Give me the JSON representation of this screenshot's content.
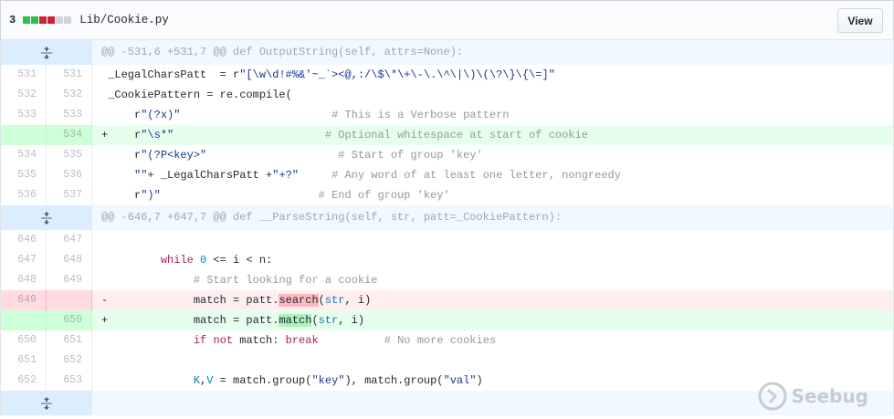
{
  "file": {
    "change_count": "3",
    "stat_colors": [
      "#2cbe4e",
      "#2cbe4e",
      "#cb2431",
      "#cb2431",
      "#d1d5da",
      "#d1d5da"
    ],
    "path": "Lib/Cookie.py",
    "view_label": "View"
  },
  "hunks": [
    {
      "header": "@@ -531,6 +531,7 @@ def OutputString(self, attrs=None):"
    },
    {
      "header": "@@ -646,7 +647,7 @@ def __ParseString(self, str, patt=_CookiePattern):"
    }
  ],
  "lines": {
    "l0": {
      "old": "531",
      "new": "531"
    },
    "l1": {
      "old": "532",
      "new": "532"
    },
    "l2": {
      "old": "533",
      "new": "533"
    },
    "l3": {
      "old": "",
      "new": "534"
    },
    "l4": {
      "old": "534",
      "new": "535"
    },
    "l5": {
      "old": "535",
      "new": "536"
    },
    "l6": {
      "old": "536",
      "new": "537"
    },
    "l7": {
      "old": "646",
      "new": "647"
    },
    "l8": {
      "old": "647",
      "new": "648"
    },
    "l9": {
      "old": "648",
      "new": "649"
    },
    "l10": {
      "old": "649",
      "new": ""
    },
    "l11": {
      "old": "",
      "new": "650"
    },
    "l12": {
      "old": "650",
      "new": "651"
    },
    "l13": {
      "old": "651",
      "new": "652"
    },
    "l14": {
      "old": "652",
      "new": "653"
    }
  },
  "code": {
    "c0": {
      "a": " _LegalCharsPatt  = r",
      "b": "\"[\\w\\d!#%&'~_`><@,:/\\$\\*\\+\\-\\.\\^\\|\\)\\(\\?\\}\\{\\=]\""
    },
    "c1": {
      "a": " _CookiePattern = re.compile("
    },
    "c2": {
      "a": "     r",
      "b": "\"(?x)\"",
      "c": "                       # This is a Verbose pattern"
    },
    "c3": {
      "a": "+    r",
      "b": "\"\\s*\"",
      "c": "                       # Optional whitespace at start of cookie"
    },
    "c4": {
      "a": "     r",
      "b": "\"(?P<key>\"",
      "c": "                    # Start of group 'key'"
    },
    "c5": {
      "a": "     ",
      "b": "\"\"",
      "d": "+ _LegalCharsPatt +",
      "e": "\"+?\"",
      "c": "     # Any word of at least one letter, nongreedy"
    },
    "c6": {
      "a": "     r",
      "b": "\")\"",
      "c": "                        # End of group 'key'"
    },
    "c7": {
      "a": ""
    },
    "c8": {
      "a": "         ",
      "kw": "while",
      "b": " ",
      "n0": "0",
      "c": " <= i < n:"
    },
    "c9": {
      "a": "              # Start looking for a cookie"
    },
    "c10": {
      "a": "-             match = patt.",
      "x": "search",
      "b": "(",
      "s": "str",
      "c": ", i)"
    },
    "c11": {
      "a": "+             match = patt.",
      "x": "match",
      "b": "(",
      "s": "str",
      "c": ", i)"
    },
    "c12": {
      "a": "              ",
      "kw1": "if",
      "b": " ",
      "kw2": "not",
      "c": " match: ",
      "kw3": "break",
      "d": "          # No more cookies"
    },
    "c13": {
      "a": ""
    },
    "c14": {
      "a": "              ",
      "k": "K",
      "b": ",",
      "v": "V",
      "c": " = match.group(",
      "s1": "\"key\"",
      "d": "), match.group(",
      "s2": "\"val\"",
      "e": ")"
    }
  },
  "watermark": {
    "text": "Seebug"
  }
}
